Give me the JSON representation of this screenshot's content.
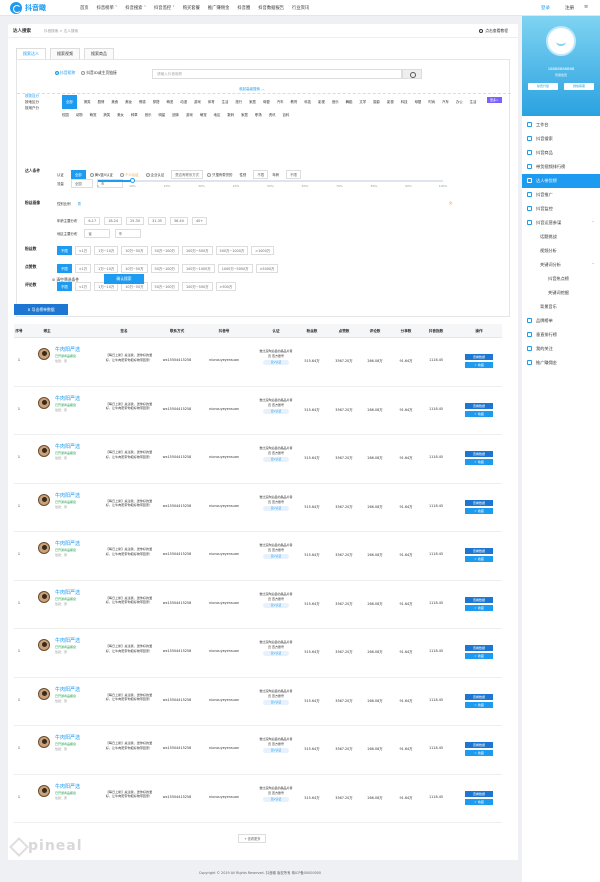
{
  "brand": {
    "name": "抖音瞰"
  },
  "topnav": {
    "items": [
      "首页",
      "抖音榜单 ˅",
      "抖音搜索 ˅",
      "抖音监控 ˅",
      "购买套餐",
      "推广赚佣金",
      "抖音圈",
      "抖音数据报告",
      "行业资讯"
    ],
    "login": "登录",
    "register": "注册",
    "menu_icon": "≡"
  },
  "breadcrumb": {
    "title": "达人搜索",
    "path": "抖音搜索   >   达人搜索",
    "help": "点击查看教程"
  },
  "tabs": [
    "搜索达人",
    "搜索视频",
    "搜索商品"
  ],
  "search": {
    "option_keyword": "抖音昵称",
    "option_url": "抖音ID或主页链接",
    "placeholder": "请输入抖音昵称"
  },
  "advanced": {
    "toggle": "收起高级搜索 ︿"
  },
  "industry_labels": [
    "按类目分",
    "按地区分",
    "按用户分"
  ],
  "categories": [
    "全部",
    "搞笑",
    "剧情",
    "美食",
    "美妆",
    "情感",
    "穿搭",
    "萌宠",
    "动漫",
    "游戏",
    "体育",
    "生活",
    "旅行",
    "家居",
    "母婴",
    "汽车",
    "教育",
    "科技",
    "影视",
    "音乐",
    "舞蹈",
    "文学",
    "摄影",
    "影视",
    "科技",
    "母婴",
    "时尚",
    "汽车",
    "办公",
    "生活",
    "校园",
    "动物",
    "萌宠",
    "搞笑",
    "美女",
    "种草",
    "音乐",
    "明星",
    "团体",
    "游戏",
    "萌宠",
    "地区",
    "数码",
    "家居",
    "职场",
    "资讯",
    "百科"
  ],
  "category_more": "更多>",
  "filters": {
    "auth": {
      "label": "达人条件",
      "prefix": "认证",
      "items": [
        "全部",
        "黄V蓝V认证",
        "个人认证",
        "企业认证",
        "是否有联系方式",
        "只搜有带货的",
        "性别",
        "不限",
        "年龄",
        "不限"
      ],
      "note": "(仅限VIP)",
      "flow_label": "流量",
      "flow_value": "全国"
    },
    "fans": {
      "label": "粉丝画像",
      "sub1": "性别比例",
      "male": "男",
      "female": "女",
      "sub2": "年龄主要分布",
      "ages": [
        "6-17",
        "18-24",
        "25-30",
        "31-35",
        "36-40",
        "40+"
      ],
      "sub3": "地区主要分布",
      "province": "省",
      "city": "市"
    },
    "slider": {
      "value": 10,
      "ticks": [
        "0",
        "10%",
        "20%",
        "30%",
        "40%",
        "50%",
        "60%",
        "70%",
        "80%",
        "90%",
        "100%"
      ]
    },
    "fans_count": {
      "label": "粉丝数",
      "items": [
        "不限",
        "<1万",
        "1万~10万",
        "10万~50万",
        "50万~100万",
        "100万~500万",
        "500万~1000万",
        ">1000万"
      ]
    },
    "likes": {
      "label": "点赞数",
      "items": [
        "不限",
        "<1万",
        "1万~10万",
        "10万~50万",
        "50万~100万",
        "100万~1000万",
        "1000万~5000万",
        ">5000万"
      ]
    },
    "comments": {
      "label": "评论数",
      "items": [
        "不限",
        "<1万",
        "1万~10万",
        "10万~50万",
        "50万~100万",
        "100万~500万",
        ">500万"
      ]
    }
  },
  "actions": {
    "clear": "清空筛选条件",
    "confirm": "确认搜索",
    "export": "导出榜单数据"
  },
  "table": {
    "headers": [
      "序号",
      "博主",
      "签名",
      "联系方式",
      "抖音号",
      "认证",
      "粉丝数",
      "点赞数",
      "评论数",
      "分享数",
      "抖音指数",
      "操作"
    ],
    "rows": [
      {
        "idx": "1",
        "name": "牛肉阳严选",
        "cert": "已开通商品橱窗",
        "gender": "性别：男",
        "sig": "【每日上新】关注我，送你好的爱好，让牛肉阳带你把好物带回家！",
        "contact": "wx15504415258",
        "account": "niunouyeyensuan",
        "auth": "数比没陶泊县的晶品片者员 查方账号",
        "auth_tag": "蓝V认证",
        "fans": "515.64万",
        "likes": "3567.20万",
        "comments": "266.08万",
        "shares": "91.64万",
        "index": "1118.45",
        "op1": "查看数据",
        "op2": "☆ 收藏"
      },
      {
        "idx": "1",
        "name": "牛肉阳严选",
        "cert": "已开通商品橱窗",
        "gender": "性别：男",
        "sig": "【每日上新】关注我，送你好的爱好，让牛肉阳带你把好物带回家！",
        "contact": "wx15504415258",
        "account": "niunouyeyensuan",
        "auth": "数比没陶泊县的晶品片者员 查方账号",
        "auth_tag": "蓝V认证",
        "fans": "515.64万",
        "likes": "3567.20万",
        "comments": "266.08万",
        "shares": "91.64万",
        "index": "1118.45",
        "op1": "查看数据",
        "op2": "☆ 收藏"
      },
      {
        "idx": "1",
        "name": "牛肉阳严选",
        "cert": "已开通商品橱窗",
        "gender": "性别：男",
        "sig": "【每日上新】关注我，送你好的爱好，让牛肉阳带你把好物带回家！",
        "contact": "wx15504415258",
        "account": "niunouyeyensuan",
        "auth": "数比没陶泊县的晶品片者员 查方账号",
        "auth_tag": "蓝V认证",
        "fans": "515.64万",
        "likes": "3567.20万",
        "comments": "266.08万",
        "shares": "91.64万",
        "index": "1118.45",
        "op1": "查看数据",
        "op2": "☆ 收藏"
      },
      {
        "idx": "1",
        "name": "牛肉阳严选",
        "cert": "已开通商品橱窗",
        "gender": "性别：男",
        "sig": "【每日上新】关注我，送你好的爱好，让牛肉阳带你把好物带回家！",
        "contact": "wx15504415258",
        "account": "niunouyeyensuan",
        "auth": "数比没陶泊县的晶品片者员 查方账号",
        "auth_tag": "蓝V认证",
        "fans": "515.64万",
        "likes": "3567.20万",
        "comments": "266.08万",
        "shares": "91.64万",
        "index": "1118.45",
        "op1": "查看数据",
        "op2": "☆ 收藏"
      },
      {
        "idx": "1",
        "name": "牛肉阳严选",
        "cert": "已开通商品橱窗",
        "gender": "性别：男",
        "sig": "【每日上新】关注我，送你好的爱好，让牛肉阳带你把好物带回家！",
        "contact": "wx15504415258",
        "account": "niunouyeyensuan",
        "auth": "数比没陶泊县的晶品片者员 查方账号",
        "auth_tag": "蓝V认证",
        "fans": "515.64万",
        "likes": "3567.20万",
        "comments": "266.08万",
        "shares": "91.64万",
        "index": "1118.45",
        "op1": "查看数据",
        "op2": "☆ 收藏"
      },
      {
        "idx": "1",
        "name": "牛肉阳严选",
        "cert": "已开通商品橱窗",
        "gender": "性别：男",
        "sig": "【每日上新】关注我，送你好的爱好，让牛肉阳带你把好物带回家！",
        "contact": "wx15504415258",
        "account": "niunouyeyensuan",
        "auth": "数比没陶泊县的晶品片者员 查方账号",
        "auth_tag": "蓝V认证",
        "fans": "515.64万",
        "likes": "3567.20万",
        "comments": "266.08万",
        "shares": "91.64万",
        "index": "1118.45",
        "op1": "查看数据",
        "op2": "☆ 收藏"
      },
      {
        "idx": "1",
        "name": "牛肉阳严选",
        "cert": "已开通商品橱窗",
        "gender": "性别：男",
        "sig": "【每日上新】关注我，送你好的爱好，让牛肉阳带你把好物带回家！",
        "contact": "wx15504415258",
        "account": "niunouyeyensuan",
        "auth": "数比没陶泊县的晶品片者员 查方账号",
        "auth_tag": "蓝V认证",
        "fans": "515.64万",
        "likes": "3567.20万",
        "comments": "266.08万",
        "shares": "91.64万",
        "index": "1118.45",
        "op1": "查看数据",
        "op2": "☆ 收藏"
      },
      {
        "idx": "1",
        "name": "牛肉阳严选",
        "cert": "已开通商品橱窗",
        "gender": "性别：男",
        "sig": "【每日上新】关注我，送你好的爱好，让牛肉阳带你把好物带回家！",
        "contact": "wx15504415258",
        "account": "niunouyeyensuan",
        "auth": "数比没陶泊县的晶品片者员 查方账号",
        "auth_tag": "蓝V认证",
        "fans": "515.64万",
        "likes": "3567.20万",
        "comments": "266.08万",
        "shares": "91.64万",
        "index": "1118.45",
        "op1": "查看数据",
        "op2": "☆ 收藏"
      },
      {
        "idx": "1",
        "name": "牛肉阳严选",
        "cert": "已开通商品橱窗",
        "gender": "性别：男",
        "sig": "【每日上新】关注我，送你好的爱好，让牛肉阳带你把好物带回家！",
        "contact": "wx15504415258",
        "account": "niunouyeyensuan",
        "auth": "数比没陶泊县的晶品片者员 查方账号",
        "auth_tag": "蓝V认证",
        "fans": "515.64万",
        "likes": "3567.20万",
        "comments": "266.08万",
        "shares": "91.64万",
        "index": "1118.45",
        "op1": "查看数据",
        "op2": "☆ 收藏"
      },
      {
        "idx": "1",
        "name": "牛肉阳严选",
        "cert": "已开通商品橱窗",
        "gender": "性别：男",
        "sig": "【每日上新】关注我，送你好的爱好，让牛肉阳带你把好物带回家！",
        "contact": "wx15504415258",
        "account": "niunouyeyensuan",
        "auth": "数比没陶泊县的晶品片者员 查方账号",
        "auth_tag": "蓝V认证",
        "fans": "515.64万",
        "likes": "3567.20万",
        "comments": "266.08万",
        "shares": "91.64万",
        "index": "1118.45",
        "op1": "查看数据",
        "op2": "☆ 收藏"
      }
    ]
  },
  "loadmore": "+ 查看更多",
  "footer": "Copyright © 2019  All Rights Reserved. 抖音瞰 版权所有  粤ICP备00000000",
  "watermark": "pineal",
  "sidebar": {
    "phone": "18888888888",
    "vip": "普通会员",
    "btn1": "续费升级",
    "btn2": "微信客服",
    "items": [
      {
        "label": "工作台",
        "type": ""
      },
      {
        "label": "抖音搜索",
        "type": ""
      },
      {
        "label": "抖音商品",
        "type": ""
      },
      {
        "label": "带货视频排行榜",
        "type": ""
      },
      {
        "label": "达人带货榜",
        "type": "active"
      },
      {
        "label": "抖音推广",
        "type": ""
      },
      {
        "label": "抖音监控",
        "type": ""
      },
      {
        "label": "抖音运营参谋",
        "type": "",
        "arrow": "˅"
      },
      {
        "label": "话题挑战",
        "type": "sub"
      },
      {
        "label": "视频分析",
        "type": "sub"
      },
      {
        "label": "关键词分析",
        "type": "sub",
        "arrow": "˅"
      },
      {
        "label": "抖音热点榜",
        "type": "sub2"
      },
      {
        "label": "关键词挖掘",
        "type": "sub2"
      },
      {
        "label": "背景音乐",
        "type": "sub"
      },
      {
        "label": "品牌榜单",
        "type": ""
      },
      {
        "label": "垂直排行榜",
        "type": ""
      },
      {
        "label": "我的关注",
        "type": ""
      },
      {
        "label": "推广赚佣金",
        "type": ""
      }
    ]
  },
  "colors": {
    "accent": "#1d9bf0",
    "dark_accent": "#1d76d2",
    "warn": "#e0473c",
    "purple": "#7b61ff"
  }
}
